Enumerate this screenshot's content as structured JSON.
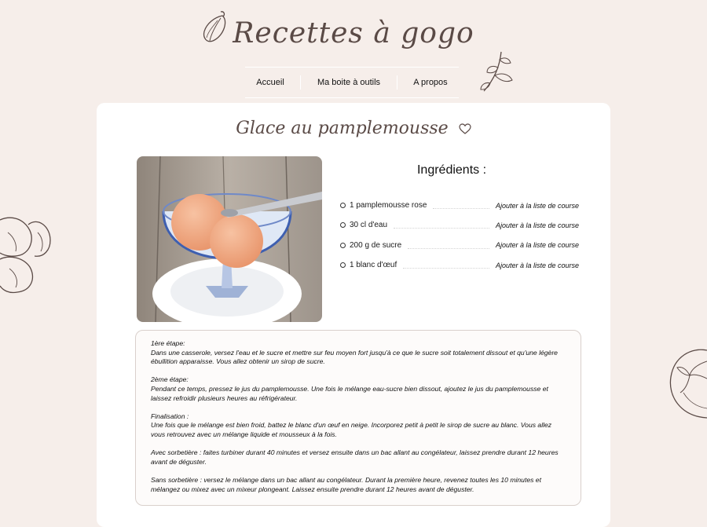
{
  "site": {
    "title": "Recettes à gogo"
  },
  "nav": {
    "items": [
      {
        "label": "Accueil"
      },
      {
        "label": "Ma boite à outils"
      },
      {
        "label": "A propos"
      }
    ]
  },
  "recipe": {
    "title": "Glace au pamplemousse",
    "ingredients_title": "Ingrédients :",
    "add_label": "Ajouter à la liste de course",
    "ingredients": [
      {
        "name": "1 pamplemousse rose"
      },
      {
        "name": "30 cl d'eau"
      },
      {
        "name": "200 g de sucre"
      },
      {
        "name": "1 blanc d'œuf"
      }
    ],
    "steps": [
      {
        "label": "1ère étape:",
        "text": "Dans une casserole, versez l'eau et le sucre et mettre sur feu moyen fort jusqu'à ce que le sucre soit totalement dissout et qu'une légère ébullition apparaisse. Vous allez obtenir un sirop de sucre."
      },
      {
        "label": "2ème étape:",
        "text": "Pendant ce temps, pressez le jus du pamplemousse. Une fois le mélange eau-sucre bien dissout, ajoutez le jus du pamplemousse et laissez refroidir plusieurs heures au réfrigérateur."
      },
      {
        "label": "Finalisation :",
        "text": "Une fois que le mélange est bien froid, battez le blanc d'un œuf en neige. Incorporez petit à petit le sirop de sucre au blanc. Vous allez vous retrouvez avec un mélange liquide et mousseux à la fois."
      },
      {
        "label": "",
        "text": "Avec sorbetière : faites turbiner durant 40 minutes et versez ensuite dans un bac allant au congélateur, laissez prendre durant 12 heures avant de déguster."
      },
      {
        "label": "",
        "text": "Sans sorbetière : versez le mélange dans un bac allant au congélateur. Durant la première heure, revenez toutes les 10 minutes et mélangez ou mixez avec un mixeur plongeant. Laissez ensuite prendre durant 12 heures avant de déguster."
      }
    ]
  },
  "icons": {
    "favorite": "heart-icon",
    "decorations": [
      "garlic-icon",
      "herb-sprig-icon",
      "garlic-bulbs-icon",
      "tomato-icon"
    ]
  },
  "colors": {
    "background": "#f6eeea",
    "card": "#ffffff",
    "title": "#5a4a46"
  }
}
